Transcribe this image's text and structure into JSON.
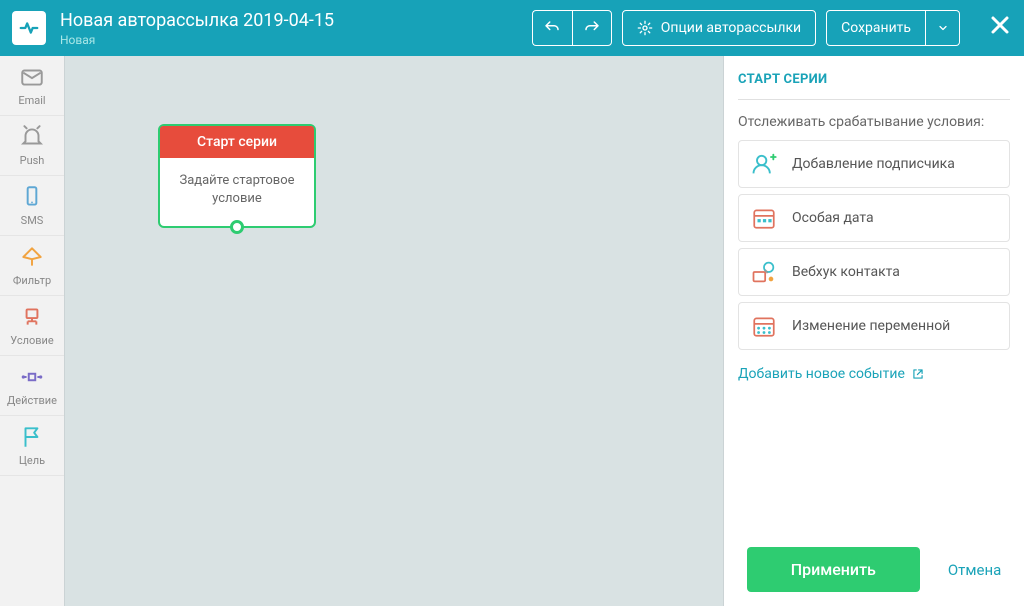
{
  "header": {
    "title": "Новая авторассылка 2019-04-15",
    "status": "Новая",
    "options_label": "Опции авторассылки",
    "save_label": "Сохранить"
  },
  "toolbox": {
    "items": [
      {
        "label": "Email",
        "color": "#999"
      },
      {
        "label": "Push",
        "color": "#999"
      },
      {
        "label": "SMS",
        "color": "#5ea7d4"
      },
      {
        "label": "Фильтр",
        "color": "#f1a340"
      },
      {
        "label": "Условие",
        "color": "#e0735e"
      },
      {
        "label": "Действие",
        "color": "#7a6cc7"
      },
      {
        "label": "Цель",
        "color": "#3abfcb"
      }
    ]
  },
  "node": {
    "title": "Старт серии",
    "body": "Задайте стартовое условие"
  },
  "panel": {
    "title": "СТАРТ СЕРИИ",
    "track_label": "Отслеживать срабатывание условия:",
    "triggers": [
      {
        "label": "Добавление подписчика"
      },
      {
        "label": "Особая дата"
      },
      {
        "label": "Вебхук контакта"
      },
      {
        "label": "Изменение переменной"
      }
    ],
    "add_event": "Добавить новое событие",
    "apply": "Применить",
    "cancel": "Отмена"
  }
}
